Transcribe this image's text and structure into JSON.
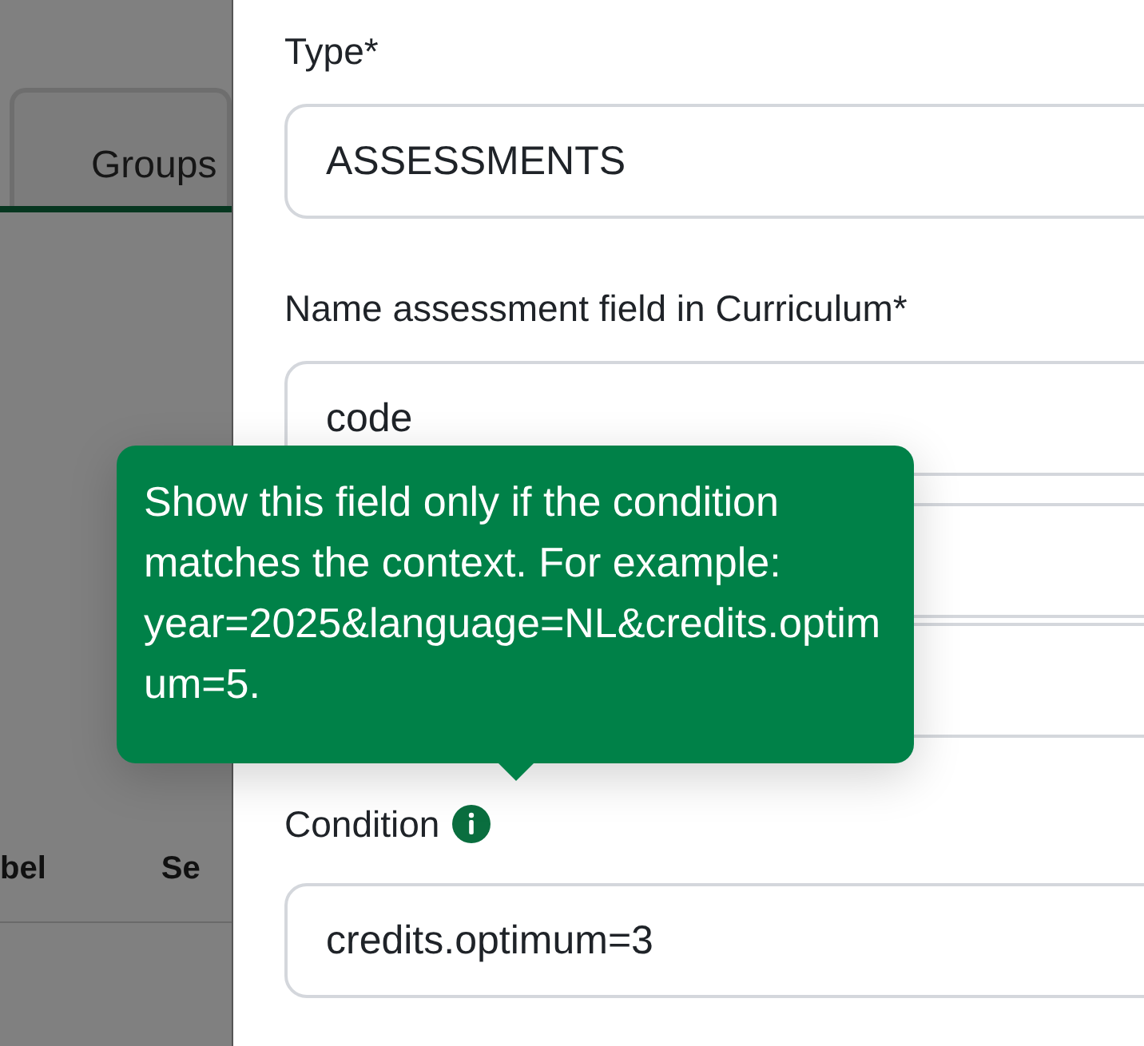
{
  "background": {
    "tabs": [
      {
        "label": "Groups"
      }
    ],
    "table_columns": [
      "bel",
      "Se"
    ]
  },
  "panel": {
    "fields": [
      {
        "kind": "text",
        "label": "Type*",
        "value": "ASSESSMENTS"
      },
      {
        "kind": "text",
        "label": "Name assessment field in Curriculum*",
        "value": "code"
      },
      {
        "kind": "covered"
      },
      {
        "kind": "covered"
      },
      {
        "kind": "text",
        "label": "Condition",
        "value": "credits.optimum=3",
        "info": true
      }
    ]
  },
  "tooltip": {
    "text": "Show this field only if the condition matches the context. For example: year=2025&language=NL&credits.optimum=5."
  }
}
